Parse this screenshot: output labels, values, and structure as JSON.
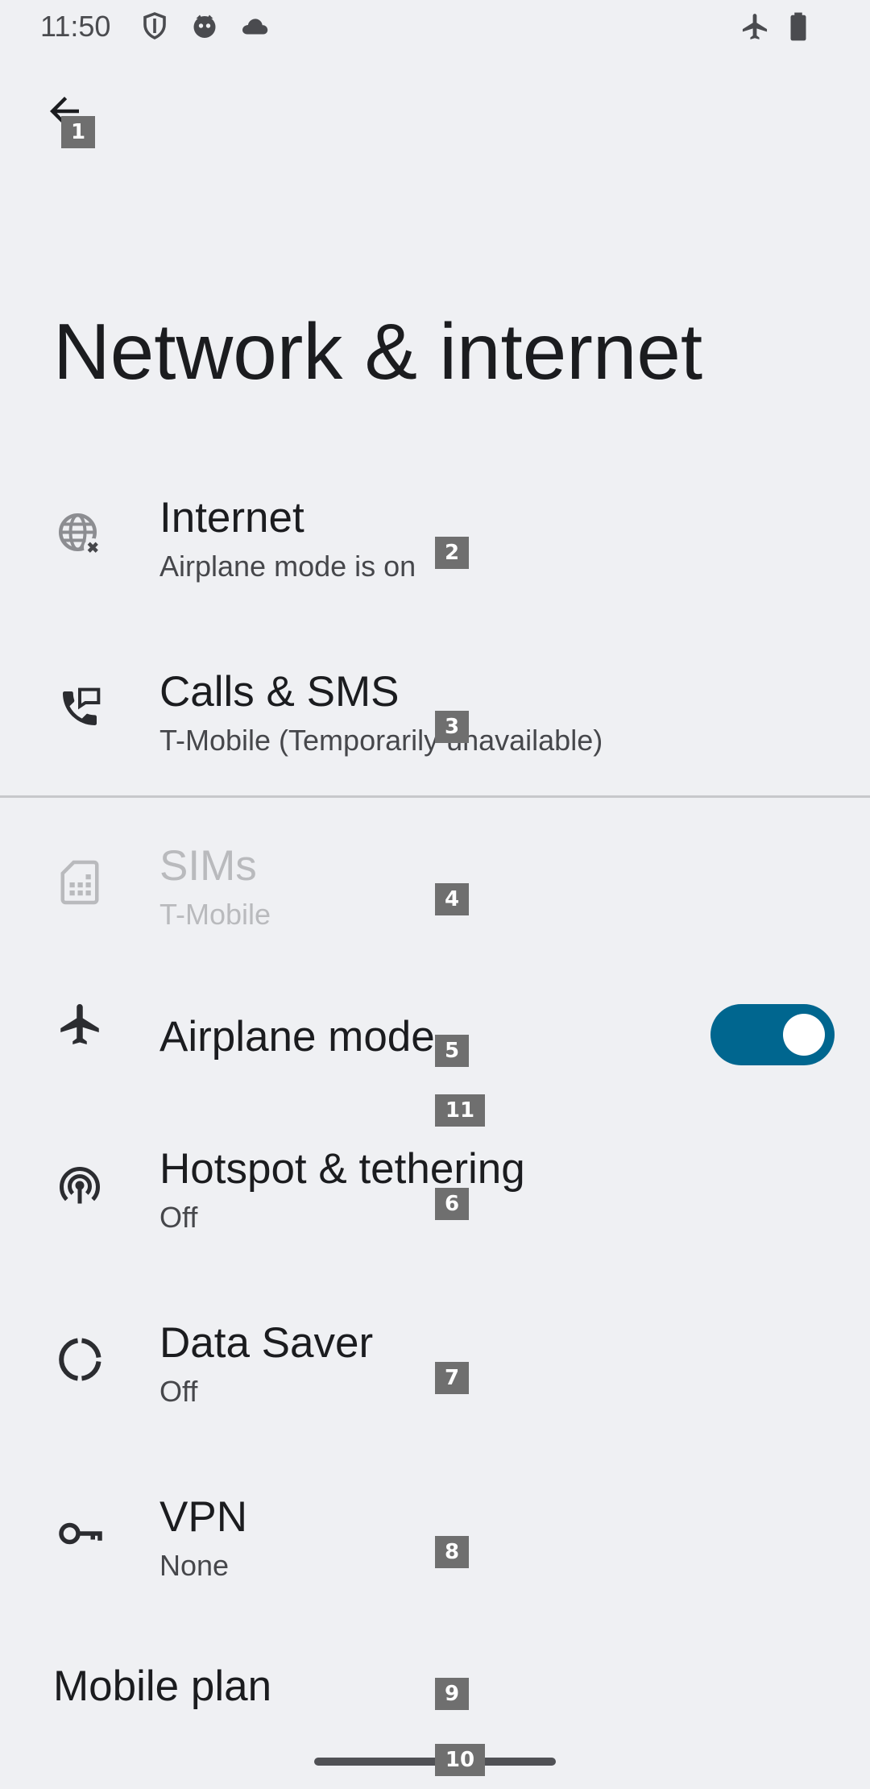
{
  "status_bar": {
    "time": "11:50",
    "left_icons": [
      "shield-icon",
      "gamepad-face-icon",
      "cloud-icon"
    ],
    "right_icons": [
      "airplane-icon",
      "battery-icon"
    ]
  },
  "page": {
    "title": "Network & internet"
  },
  "items": [
    {
      "title": "Internet",
      "summary": "Airplane mode is on",
      "icon": "globe-off-icon"
    },
    {
      "title": "Calls & SMS",
      "summary": "T-Mobile (Temporarily unavailable)",
      "icon": "call-sms-icon"
    },
    {
      "title": "SIMs",
      "summary": "T-Mobile",
      "icon": "sim-card-icon",
      "enabled": false
    },
    {
      "title": "Airplane mode",
      "icon": "airplane-icon",
      "toggle_on": true
    },
    {
      "title": "Hotspot & tethering",
      "summary": "Off",
      "icon": "hotspot-icon"
    },
    {
      "title": "Data Saver",
      "summary": "Off",
      "icon": "data-saver-icon"
    },
    {
      "title": "VPN",
      "summary": "None",
      "icon": "vpn-key-icon"
    }
  ],
  "mobile_plan": {
    "title": "Mobile plan"
  },
  "overlay_tags": [
    "1",
    "2",
    "3",
    "4",
    "5",
    "6",
    "7",
    "8",
    "9",
    "10",
    "11"
  ],
  "colors": {
    "background": "#eff0f3",
    "accent_toggle": "#00668f",
    "text_primary": "#1b1c1f",
    "text_secondary": "#46474b",
    "text_disabled": "#b9babd",
    "tag_bg": "#6f6f6f"
  }
}
